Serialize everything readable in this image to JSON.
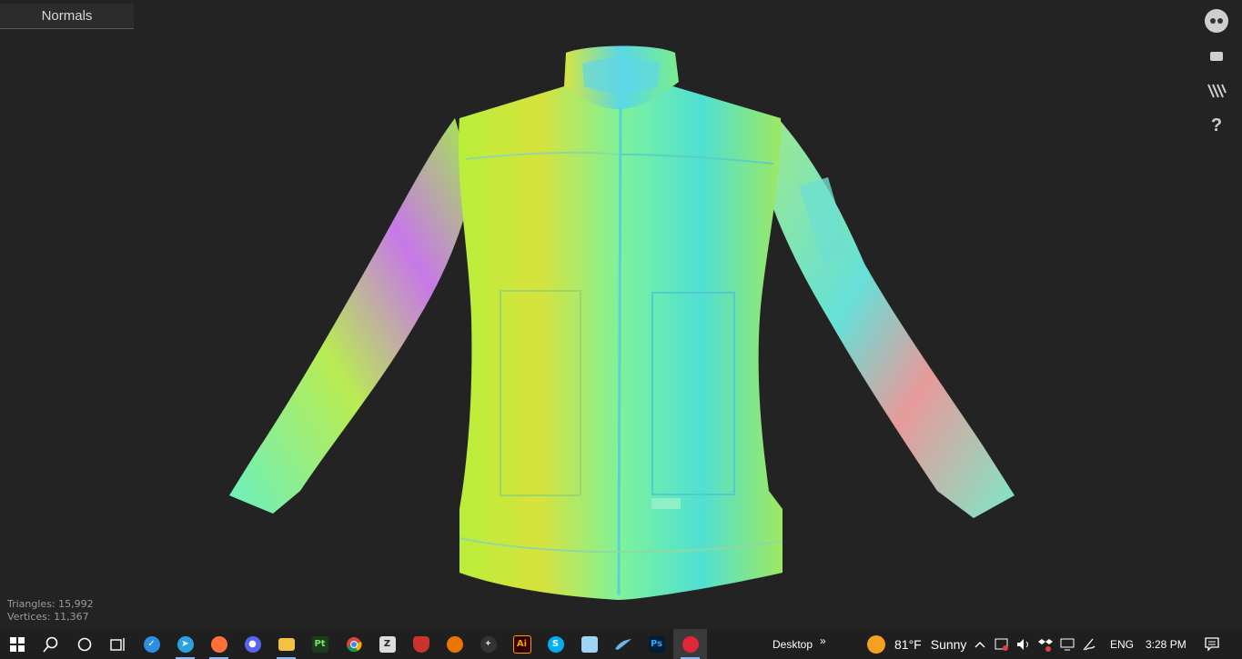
{
  "viewer": {
    "mode_label": "Normals",
    "stats": {
      "triangles": "Triangles: 15,992",
      "vertices": "Vertices: 11,367"
    },
    "tools": [
      "user-icon",
      "message-icon",
      "layers-icon",
      "help-icon"
    ],
    "help_glyph": "?"
  },
  "taskbar": {
    "apps": [
      {
        "name": "start",
        "icon": "windows-icon"
      },
      {
        "name": "search",
        "icon": "search-icon"
      },
      {
        "name": "cortana",
        "icon": "circle-icon"
      },
      {
        "name": "task-view",
        "icon": "task-view-icon"
      },
      {
        "name": "vscode-like",
        "icon": "check-app-icon",
        "color": "#2d8ee0"
      },
      {
        "name": "telegram",
        "icon": "telegram-icon",
        "color": "#2aa3e0"
      },
      {
        "name": "firefox",
        "icon": "firefox-icon",
        "color": "#ff7139"
      },
      {
        "name": "discord",
        "icon": "discord-icon",
        "color": "#5865f2"
      },
      {
        "name": "file-explorer",
        "icon": "folder-icon",
        "color": "#f3c244"
      },
      {
        "name": "painter",
        "icon": "pt-icon",
        "label": "Pt",
        "color": "#1c3d1c",
        "fg": "#7ee16a"
      },
      {
        "name": "chrome",
        "icon": "chrome-icon"
      },
      {
        "name": "zbrush",
        "icon": "zbrush-icon"
      },
      {
        "name": "shield-app",
        "icon": "shield-app-icon",
        "color": "#c8342b"
      },
      {
        "name": "blender",
        "icon": "blender-icon",
        "color": "#ea7600"
      },
      {
        "name": "marmoset",
        "icon": "marmoset-icon"
      },
      {
        "name": "illustrator",
        "icon": "ai-icon",
        "label": "Ai",
        "color": "#330000",
        "fg": "#ff9a00"
      },
      {
        "name": "skype",
        "icon": "skype-icon",
        "label": "S",
        "color": "#00aff0",
        "fg": "#fff"
      },
      {
        "name": "notepad",
        "icon": "notepad-icon"
      },
      {
        "name": "substance",
        "icon": "wing-app-icon"
      },
      {
        "name": "photoshop",
        "icon": "ps-icon",
        "label": "Ps",
        "color": "#001e36",
        "fg": "#31a8ff"
      },
      {
        "name": "sketchfab",
        "icon": "sketchfab-icon",
        "color": "#e0263b"
      }
    ],
    "desktop_label": "Desktop",
    "desktop_chevron": "»",
    "weather": {
      "temp": "81°F",
      "condition": "Sunny"
    },
    "lang": "ENG",
    "time": "3:28 PM"
  }
}
